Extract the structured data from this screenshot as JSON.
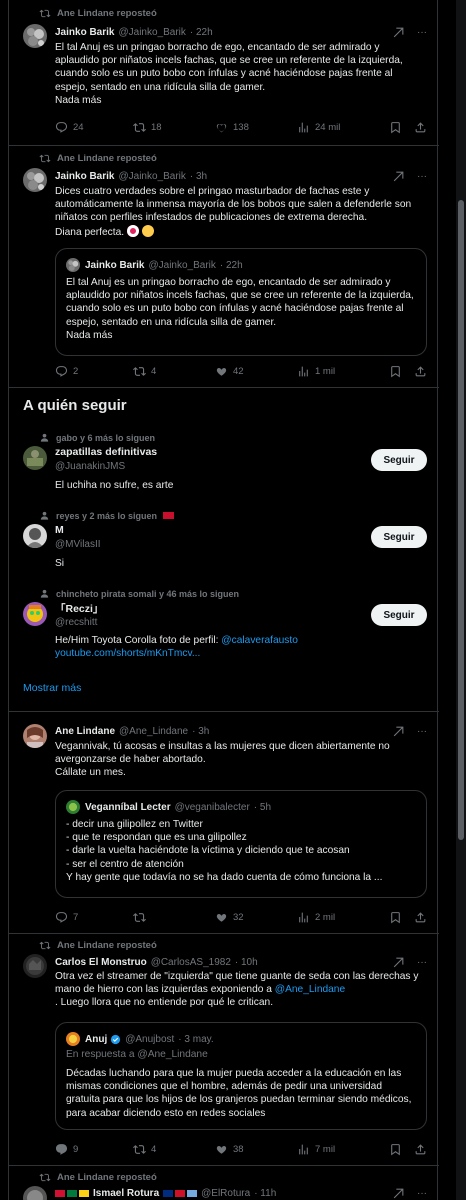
{
  "tweets": [
    {
      "repost_label": "Ane Lindane reposteó",
      "name": "Jainko Barik",
      "handle": "@Jainko_Barik",
      "time": "· 22h",
      "text": "El tal Anuj es un pringao borracho de ego, encantado de ser admirado y aplaudido por niñatos incels fachas, que se cree un referente de la izquierda, cuando solo es un puto bobo con ínfulas y acné haciéndose pajas frente al espejo, sentado en una ridícula silla de gamer.\nNada más",
      "replies": "24",
      "reposts": "18",
      "likes": "138",
      "views": "24 mil"
    },
    {
      "repost_label": "Ane Lindane reposteó",
      "name": "Jainko Barik",
      "handle": "@Jainko_Barik",
      "time": "· 3h",
      "text": "Dices cuatro verdades sobre el pringao masturbador de fachas este y automáticamente la inmensa mayoría de los bobos que salen a defenderle son niñatos con perfiles infestados de publicaciones de extrema derecha.\nDiana perfecta.",
      "quote": {
        "name": "Jainko Barik",
        "handle": "@Jainko_Barik",
        "time": "· 22h",
        "text": "El tal Anuj es un pringao borracho de ego, encantado de ser admirado y aplaudido por niñatos incels fachas, que se cree un referente de la izquierda, cuando solo es un puto bobo con ínfulas y acné haciéndose pajas frente al espejo, sentado en una ridícula silla de gamer.\nNada más"
      },
      "replies": "2",
      "reposts": "4",
      "likes": "42",
      "views": "1 mil"
    },
    {
      "name": "Ane Lindane",
      "handle": "@Ane_Lindane",
      "time": "· 3h",
      "text": "Veganniv​ak, tú acosas e insultas a las mujeres que dicen abiertamente no avergonzarse de haber abortado.\nCállate un mes.",
      "quote": {
        "name": "Veganníbal Lecter",
        "handle": "@veganibalecter",
        "time": "· 5h",
        "text": "- decir una gilipollez en Twitter\n- que te respondan que es una gilipollez\n- darle la vuelta haciéndote la víctima y diciendo que te acosan\n- ser el centro de atención\nY hay gente que todavía no se ha dado cuenta de cómo funciona la ..."
      },
      "replies": "7",
      "reposts": "",
      "likes": "32",
      "views": "2 mil"
    },
    {
      "repost_label": "Ane Lindane reposteó",
      "name": "Carlos El Monstruo",
      "handle": "@CarlosAS_1982",
      "time": "· 10h",
      "text_parts": [
        "Otra vez el streamer de \"izquierda\" que tiene guante de seda con las derechas y mano de hierro con las  izquierdas exponiendo a ",
        "@Ane_Lindane",
        "\n. Luego llora que no entiende por qué le critican."
      ],
      "quote": {
        "name": "Anuj",
        "handle": "@Anujbost",
        "time": "· 3 may.",
        "reply_to": "En respuesta a @Ane_Lindane",
        "text": "Décadas luchando para que la mujer pueda acceder a la educación en las mismas condiciones que el hombre, además de pedir una universidad gratuita para que los hijos de los granjeros puedan terminar siendo médicos, para acabar diciendo esto en redes sociales"
      },
      "replies": "9",
      "reposts": "4",
      "likes": "38",
      "views": "7 mil"
    },
    {
      "repost_label": "Ane Lindane reposteó",
      "name": "Ismael Rotura",
      "handle": "@ElRotura",
      "time": "· 11h"
    }
  ],
  "who_to_follow": {
    "title": "A quién seguir",
    "follow_label": "Seguir",
    "show_more": "Mostrar más",
    "accounts": [
      {
        "context": "gabo y 6 más lo siguen",
        "name": "zapatillas definitivas",
        "handle": "@JuanakinJMS",
        "bio": "El uchiha no sufre, es arte"
      },
      {
        "context": "reyes y 2 más lo siguen",
        "name": "M",
        "handle": "@MVilasII",
        "bio": "Si"
      },
      {
        "context": "chincheto pirata somali y 46 más lo siguen",
        "name": "「Reczi」",
        "handle": "@recshitt",
        "bio_prefix": "He/Him Toyota Corolla foto de perfil: ",
        "bio_link": "@calaverafausto",
        "bio_url": "youtube.com/shorts/mKnTmcv..."
      }
    ]
  },
  "colors": {
    "accent": "#1d9bf0",
    "muted": "#71767b",
    "border": "#2f3336",
    "bg": "#000000"
  }
}
